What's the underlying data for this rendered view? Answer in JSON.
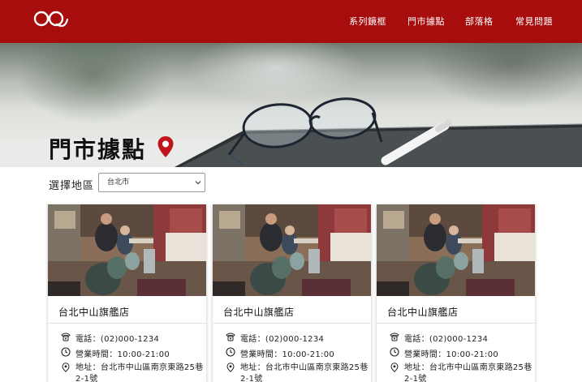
{
  "header": {
    "logo_icon": "glasses-logo-icon",
    "nav": [
      {
        "label": "系列鏡框"
      },
      {
        "label": "門市據點"
      },
      {
        "label": "部落格"
      },
      {
        "label": "常見問題"
      }
    ],
    "background_color": "#a80d0d"
  },
  "hero": {
    "title": "門市據點",
    "pin_icon": "location-pin-icon",
    "pin_color": "#c0161b"
  },
  "filter": {
    "label": "選擇地區",
    "selected": "台北市"
  },
  "stores": [
    {
      "name": "台北中山旗艦店",
      "phone": "電話：(02)000-1234",
      "hours": "營業時間：10:00-21:00",
      "address": "地址：台北市中山區南京東路25巷2-1號"
    },
    {
      "name": "台北中山旗艦店",
      "phone": "電話：(02)000-1234",
      "hours": "營業時間：10:00-21:00",
      "address": "地址：台北市中山區南京東路25巷2-1號"
    },
    {
      "name": "台北中山旗艦店",
      "phone": "電話：(02)000-1234",
      "hours": "營業時間：10:00-21:00",
      "address": "地址：台北市中山區南京東路25巷2-1號"
    }
  ],
  "icons": {
    "phone": "phone-icon",
    "clock": "clock-icon",
    "location": "location-icon"
  }
}
